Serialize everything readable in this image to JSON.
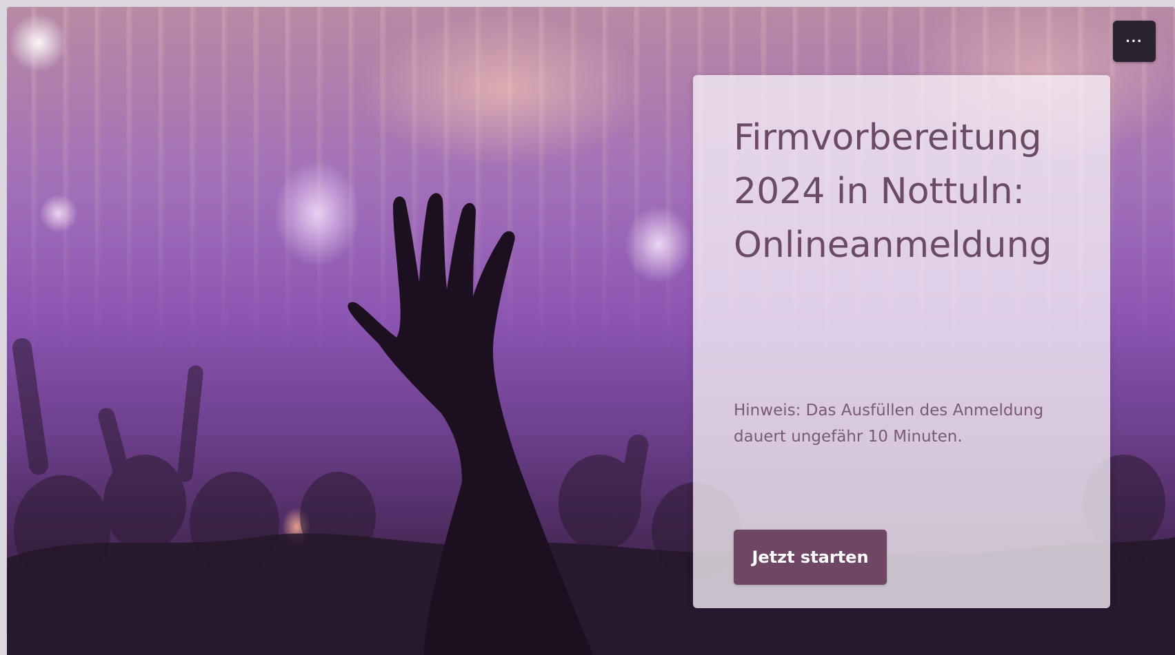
{
  "menu": {
    "more_label": "···"
  },
  "form": {
    "title": "Firmvorbereitung 2024 in Nottuln: Onlineanmeldung",
    "hint": "Hinweis: Das Ausfüllen des Anmeldung dauert ungefähr 10 Minuten.",
    "start_label": "Jetzt starten"
  },
  "theme": {
    "accent": "#6f4663",
    "title_color": "#6b4a66",
    "card_background": "#f6f0f6"
  },
  "background": {
    "image": "concert-crowd-raised-hand",
    "icon": "raised-hand"
  }
}
